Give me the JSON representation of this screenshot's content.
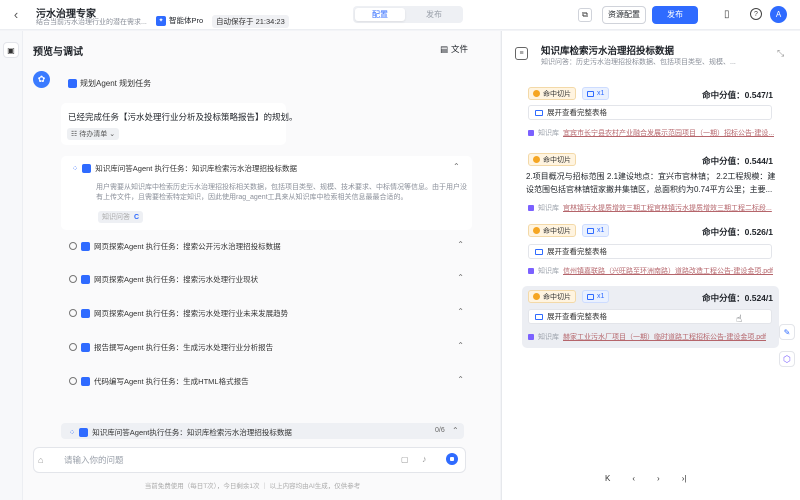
{
  "header": {
    "app_title": "污水治理专家",
    "app_desc": "结合当前污水治理行业的潜在需求...",
    "model": "智能体Pro",
    "autosave": "自动保存于 21:34:23",
    "tab_config": "配置",
    "tab_publish": "发布",
    "resource_btn": "资源配置",
    "publish_btn": "发布",
    "avatar": "A"
  },
  "left": {
    "title": "预览与调试",
    "file_btn": "文件",
    "plan_label": "规划Agent 规划任务",
    "plan_text": "已经完成任务【污水处理行业分析及投标策略报告】的规划。",
    "todo_chip": "待办清单",
    "task1": {
      "title": "知识库问答Agent 执行任务：知识库检索污水治理招投标数据",
      "body": "用户需要从知识库中检索历史污水治理招投标相关数据，包括项目类型、规模、技术要求、中标情况等信息。由于用户没有上传文件，且需要检索特定知识，因此使用rag_agent工具来从知识库中检索相关信息最最合适的。",
      "chip": "知识问答",
      "chip_mark": "C"
    },
    "tasks": [
      "网页探索Agent 执行任务：搜索公开污水治理招投标数据",
      "网页探索Agent 执行任务：搜索污水处理行业现状",
      "网页探索Agent 执行任务：搜索污水处理行业未来发展趋势",
      "报告撰写Agent 执行任务：生成污水处理行业分析报告",
      "代码编写Agent 执行任务：生成HTML格式报告"
    ],
    "subtask": {
      "title": "知识库问答Agent执行任务：知识库检索污水治理招投标数据",
      "count": "0/6"
    },
    "input_placeholder": "请输入你的问题",
    "footnote": "当前免费使用（每日T次），今日剩余1次 ｜ 以上内容均由AI生成，仅供参考"
  },
  "right": {
    "title": "知识库检索污水治理招投标数据",
    "query_label": "知识问答：",
    "query_text": "历史污水治理招投标数据、包括项目类型、规模、...",
    "results": [
      {
        "hit": "命中切片",
        "x": "x1",
        "score": "命中分值：0.547/1",
        "expand": "展开查看完整表格",
        "kb": "知识库",
        "source": "宜宾市长宁县农村产业融合发展示范园项目（一期）招标公告-建设..."
      },
      {
        "hit": "命中切片",
        "score": "命中分值：0.544/1",
        "body": "2.项目概况与招标范围 2.1建设地点：宜兴市官林镇； 2.2工程规模：建设范围包括官林镇钮家撇井集镇区，总面积约为0.74平方公里；主要...",
        "kb": "知识库",
        "source": "官林镇污水提质增效三期工程官林镇污水提质增效三期工程二标段..."
      },
      {
        "hit": "命中切片",
        "x": "x1",
        "score": "命中分值：0.526/1",
        "expand": "展开查看完整表格",
        "kb": "知识库",
        "source": "信州镇嘉联路（兴旺路至环洲南路）道路改造工程公告-建设金项.pdf"
      },
      {
        "hit": "命中切片",
        "x": "x1",
        "score": "命中分值：0.524/1",
        "expand": "展开查看完整表格",
        "kb": "知识库",
        "source": "赫家工业污水厂项目（一期）临时道路工程招标公告-建设金项.pdf"
      }
    ],
    "pager": [
      "K",
      "‹",
      "›",
      "›|"
    ]
  },
  "icons": {
    "back": "back-chevron-icon",
    "copy": "copy-icon",
    "book": "book-icon",
    "help": "help-icon",
    "file": "file-icon",
    "clock": "clock-icon",
    "send": "send-icon",
    "mic": "mic-icon",
    "collapse": "collapse-icon"
  },
  "colors": {
    "primary": "#2f6bff",
    "hit_chip": "#fff4e0",
    "source_link": "#b5656b"
  }
}
